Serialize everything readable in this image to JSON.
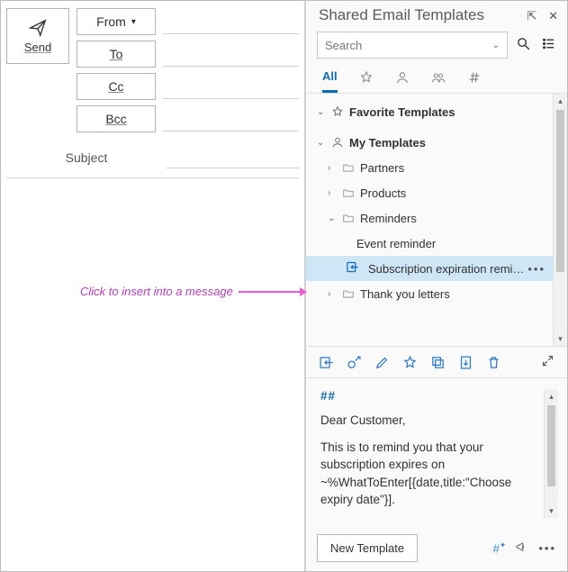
{
  "compose": {
    "send_label": "Send",
    "from_label": "From",
    "to_label": "To",
    "cc_label": "Cc",
    "bcc_label": "Bcc",
    "subject_label": "Subject"
  },
  "annotation": {
    "text": "Click to insert into a message"
  },
  "pane": {
    "title": "Shared Email Templates",
    "search_placeholder": "Search",
    "tabs": {
      "all_label": "All"
    },
    "tree": {
      "favorite_label": "Favorite Templates",
      "my_label": "My Templates",
      "folders": {
        "partners": "Partners",
        "products": "Products",
        "reminders": "Reminders",
        "thankyou": "Thank you letters"
      },
      "reminder_items": {
        "event": "Event reminder",
        "subscription": "Subscription expiration remi…"
      }
    },
    "preview": {
      "tag": "##",
      "line1": "Dear Customer,",
      "line2": "This is to remind you that your subscription expires on ~%WhatToEnter[{date,title:\"Choose expiry date\"}]."
    },
    "footer": {
      "new_template_label": "New Template",
      "hash_label": "#✦"
    }
  }
}
